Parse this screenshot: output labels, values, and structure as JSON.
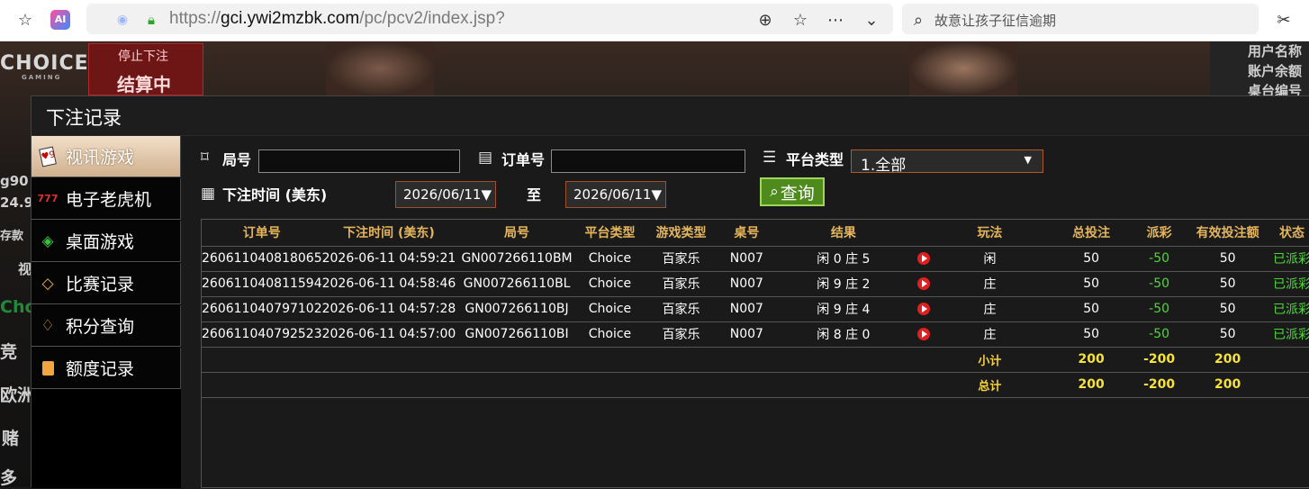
{
  "browser": {
    "url_prefix": "https://",
    "url_host": "gci.ywi2mzbk.com",
    "url_path": "/pc/pcv2/index.jsp?",
    "search_text": "故意让孩子征信逾期",
    "icons": [
      "favorites-icon",
      "ai-icon",
      "tracking-icon",
      "lock-icon",
      "extension-icon",
      "star-icon",
      "more-icon",
      "chevron-down-icon",
      "search-icon",
      "scissors-icon"
    ]
  },
  "background": {
    "logo": "CHOICE",
    "logo_sub": "GAMING",
    "stop_bet": "停止下注",
    "settling": "结算中",
    "right_lines": [
      "用户名称",
      "账户余额",
      "桌台编号"
    ],
    "left_lines": [
      "g90",
      "24.9",
      "存款",
      "视",
      "Cho",
      "竞",
      "欧洲",
      "赌",
      "多"
    ]
  },
  "modal": {
    "title": "下注记录"
  },
  "sidebar": {
    "items": [
      {
        "label": "视讯游戏",
        "icon": "cards-icon",
        "active": true
      },
      {
        "label": "电子老虎机",
        "icon": "slot-777-icon",
        "active": false
      },
      {
        "label": "桌面游戏",
        "icon": "chips-icon",
        "active": false
      },
      {
        "label": "比赛记录",
        "icon": "ticket-icon",
        "active": false
      },
      {
        "label": "积分查询",
        "icon": "diamond-icon",
        "active": false
      },
      {
        "label": "额度记录",
        "icon": "document-icon",
        "active": false
      }
    ]
  },
  "filters": {
    "round_label": "局号",
    "round_value": "",
    "order_label": "订单号",
    "order_value": "",
    "platform_label": "平台类型",
    "platform_value": "1.全部",
    "time_label": "下注时间 (美东)",
    "date_from": "2026/06/11",
    "to_label": "至",
    "date_to": "2026/06/11",
    "query_label": "查询"
  },
  "table": {
    "headers": [
      "订单号",
      "下注时间 (美东)",
      "局号",
      "平台类型",
      "游戏类型",
      "桌号",
      "结果",
      "",
      "玩法",
      "总投注",
      "派彩",
      "有效投注额",
      "状态"
    ],
    "rows": [
      {
        "order": "260611040818065",
        "time": "2026-06-11 04:59:21",
        "round": "GN007266110BM",
        "platform": "Choice",
        "game": "百家乐",
        "table": "N007",
        "result": "闲 0 庄 5",
        "play": "闲",
        "bet": "50",
        "payout": "-50",
        "valid": "50",
        "status": "已派彩"
      },
      {
        "order": "260611040811594",
        "time": "2026-06-11 04:58:46",
        "round": "GN007266110BL",
        "platform": "Choice",
        "game": "百家乐",
        "table": "N007",
        "result": "闲 9 庄 2",
        "play": "庄",
        "bet": "50",
        "payout": "-50",
        "valid": "50",
        "status": "已派彩"
      },
      {
        "order": "260611040797102",
        "time": "2026-06-11 04:57:28",
        "round": "GN007266110BJ",
        "platform": "Choice",
        "game": "百家乐",
        "table": "N007",
        "result": "闲 9 庄 4",
        "play": "庄",
        "bet": "50",
        "payout": "-50",
        "valid": "50",
        "status": "已派彩"
      },
      {
        "order": "260611040792523",
        "time": "2026-06-11 04:57:00",
        "round": "GN007266110BI",
        "platform": "Choice",
        "game": "百家乐",
        "table": "N007",
        "result": "闲 8 庄 0",
        "play": "庄",
        "bet": "50",
        "payout": "-50",
        "valid": "50",
        "status": "已派彩"
      }
    ],
    "subtotal": {
      "label": "小计",
      "bet": "200",
      "payout": "-200",
      "valid": "200"
    },
    "total": {
      "label": "总计",
      "bet": "200",
      "payout": "-200",
      "valid": "200"
    }
  },
  "colors": {
    "header_text": "#e4b55c",
    "positive_status": "#50d63a",
    "sum_text": "#f5e23c",
    "query_button": "#4f8a1d",
    "active_menu": "#cfb08e"
  }
}
